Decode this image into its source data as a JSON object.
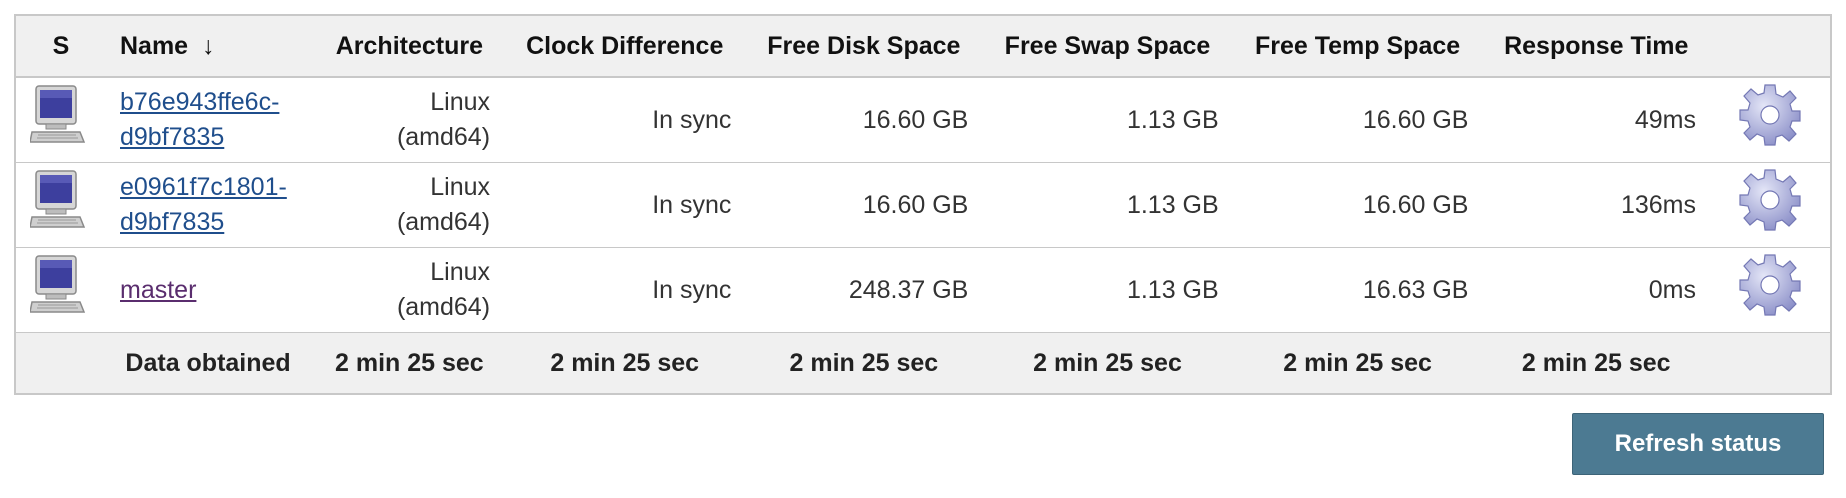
{
  "table": {
    "headers": {
      "status": "S",
      "name": "Name",
      "name_sort": "↓",
      "architecture": "Architecture",
      "clock_difference": "Clock Difference",
      "free_disk_space": "Free Disk Space",
      "free_swap_space": "Free Swap Space",
      "free_temp_space": "Free Temp Space",
      "response_time": "Response Time"
    },
    "rows": [
      {
        "icon": "computer-icon",
        "name_line1": "b76e943ffe6c-",
        "name_line2": "d9bf7835",
        "arch_line1": "Linux",
        "arch_line2": "(amd64)",
        "clock": "In sync",
        "disk": "16.60 GB",
        "swap": "1.13 GB",
        "temp": "16.60 GB",
        "response": "49ms",
        "action_icon": "gear-icon"
      },
      {
        "icon": "computer-icon",
        "name_line1": "e0961f7c1801-",
        "name_line2": "d9bf7835",
        "arch_line1": "Linux",
        "arch_line2": "(amd64)",
        "clock": "In sync",
        "disk": "16.60 GB",
        "swap": "1.13 GB",
        "temp": "16.60 GB",
        "response": "136ms",
        "action_icon": "gear-icon"
      },
      {
        "icon": "computer-icon",
        "name_line1": "master",
        "name_line2": "",
        "arch_line1": "Linux",
        "arch_line2": "(amd64)",
        "clock": "In sync",
        "disk": "248.37 GB",
        "swap": "1.13 GB",
        "temp": "16.63 GB",
        "response": "0ms",
        "action_icon": "gear-icon"
      }
    ],
    "summary": {
      "label": "Data obtained",
      "architecture": "2 min 25 sec",
      "clock_difference": "2 min 25 sec",
      "free_disk_space": "2 min 25 sec",
      "free_swap_space": "2 min 25 sec",
      "free_temp_space": "2 min 25 sec",
      "response_time": "2 min 25 sec"
    }
  },
  "refresh_button": {
    "label": "Refresh status"
  },
  "colors": {
    "link": "#1f4e8c",
    "visited_link": "#5a2d6e",
    "header_bg": "#f0f0f0",
    "button_bg": "#4c7a92"
  }
}
